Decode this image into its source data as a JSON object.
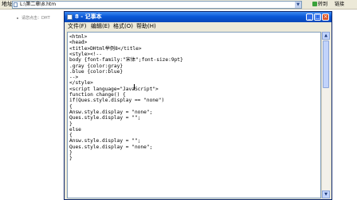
{
  "browser": {
    "address_label": "地址(D)",
    "address_value": "L:\\第二章\\8.htm",
    "go_label": "转到",
    "links_label": "链接"
  },
  "page": {
    "left_link": "请您点击：DHT"
  },
  "notepad": {
    "title": "8 - 记事本",
    "menu": [
      "文件(F)",
      "编辑(E)",
      "格式(O)",
      "帮助(H)"
    ],
    "code_lines": [
      "<html>",
      "<head>",
      "<title>DHtml举例8</title>",
      "<style><!--",
      "body {font-family:\"宋体\";font-size:9pt}",
      ".gray {color:gray}",
      ".blue {color:blue}",
      "-->",
      "</style>",
      "<script language=\"JavaScript\">",
      "function change() {",
      "if(Ques.style.display == \"none\")",
      "{",
      "Answ.style.display = \"none\";",
      "Ques.style.display = \"\";",
      "}",
      "else",
      "{",
      "Answ.style.display = \"\";",
      "Ques.style.display = \"none\";",
      "}",
      "}"
    ]
  },
  "colors": {
    "titlebar": "#0a58d8",
    "chrome": "#ece9d8",
    "editor_bg": "#ffffff"
  }
}
